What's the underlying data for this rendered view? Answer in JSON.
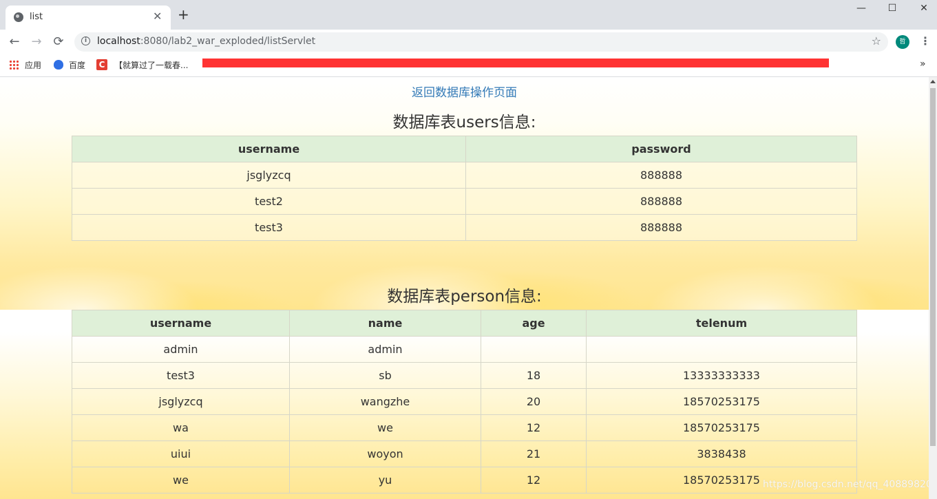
{
  "browser": {
    "tab_title": "list",
    "tab_close": "✕",
    "new_tab": "+",
    "window_controls": {
      "minimize": "—",
      "maximize": "☐",
      "close": "✕"
    },
    "nav": {
      "back": "←",
      "forward": "→",
      "reload": "⟳"
    },
    "url_host": "localhost",
    "url_rest": ":8080/lab2_war_exploded/listServlet",
    "info_icon": "i",
    "star_icon": "☆",
    "avatar_text": "哲",
    "menu_icon": "⋮",
    "bookmarks": [
      {
        "label": "应用",
        "icon": "apps-grid-icon"
      },
      {
        "label": "百度",
        "icon": "baidu-icon"
      },
      {
        "label": "【就算过了一载春...",
        "icon": "csdn-icon"
      }
    ],
    "csdn_letter": "C",
    "bookmarks_more": "»"
  },
  "page": {
    "back_link": "返回数据库操作页面",
    "users_title": "数据库表users信息:",
    "users_table": {
      "headers": [
        "username",
        "password"
      ],
      "rows": [
        [
          "jsglyzcq",
          "888888"
        ],
        [
          "test2",
          "888888"
        ],
        [
          "test3",
          "888888"
        ]
      ]
    },
    "person_title": "数据库表person信息:",
    "person_table": {
      "headers": [
        "username",
        "name",
        "age",
        "telenum"
      ],
      "rows": [
        [
          "admin",
          "admin",
          "",
          ""
        ],
        [
          "test3",
          "sb",
          "18",
          "13333333333"
        ],
        [
          "jsglyzcq",
          "wangzhe",
          "20",
          "18570253175"
        ],
        [
          "wa",
          "we",
          "12",
          "18570253175"
        ],
        [
          "uiui",
          "woyon",
          "21",
          "3838438"
        ],
        [
          "we",
          "yu",
          "12",
          "18570253175"
        ]
      ]
    },
    "watermark": "https://blog.csdn.net/qq_40889820"
  },
  "colors": {
    "header_bg": "#dff0d8",
    "link": "#337ab7",
    "redaction": "#ff3333"
  }
}
